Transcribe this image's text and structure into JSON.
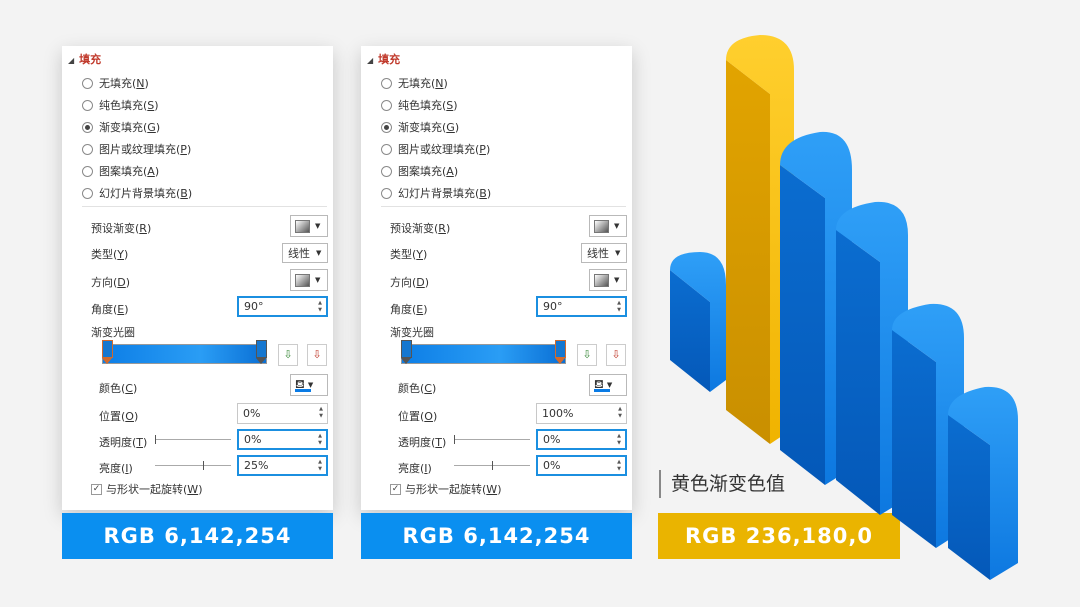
{
  "section_title": "填充",
  "fill_options": [
    {
      "label": "无填充(",
      "key": "N",
      "checked": false
    },
    {
      "label": "纯色填充(",
      "key": "S",
      "checked": false
    },
    {
      "label": "渐变填充(",
      "key": "G",
      "checked": true
    },
    {
      "label": "图片或纹理填充(",
      "key": "P",
      "checked": false
    },
    {
      "label": "图案填充(",
      "key": "A",
      "checked": false
    },
    {
      "label": "幻灯片背景填充(",
      "key": "B",
      "checked": false
    }
  ],
  "close_paren": ")",
  "labels": {
    "preset": "预设渐变(",
    "preset_key": "R",
    "type": "类型(",
    "type_key": "Y",
    "direction": "方向(",
    "direction_key": "D",
    "angle": "角度(",
    "angle_key": "E",
    "stops": "渐变光圈",
    "color": "颜色(",
    "color_key": "C",
    "position": "位置(",
    "position_key": "O",
    "transparency": "透明度(",
    "transparency_key": "T",
    "brightness": "亮度(",
    "brightness_key": "I",
    "rotate": "与形状一起旋转(",
    "rotate_key": "W"
  },
  "panel1": {
    "type_value": "线性",
    "angle_value": "90°",
    "position_value": "0%",
    "transparency_value": "0%",
    "brightness_value": "25%",
    "selected_stop": "left",
    "banner": "RGB 6,142,254"
  },
  "panel2": {
    "type_value": "线性",
    "angle_value": "90°",
    "position_value": "100%",
    "transparency_value": "0%",
    "brightness_value": "0%",
    "selected_stop": "right",
    "banner": "RGB 6,142,254"
  },
  "caption": "黄色渐变色值",
  "banner_yellow": "RGB 236,180,0",
  "icons": {
    "expand": "triangle-icon",
    "dropdown": "chevron-down-icon",
    "add_stop": "add-stop-icon",
    "remove_stop": "remove-stop-icon",
    "paint": "paint-bucket-icon"
  },
  "colors": {
    "blue": "#0a8ff0",
    "yellow": "#eab400",
    "highlight": "#1b8fe0"
  }
}
